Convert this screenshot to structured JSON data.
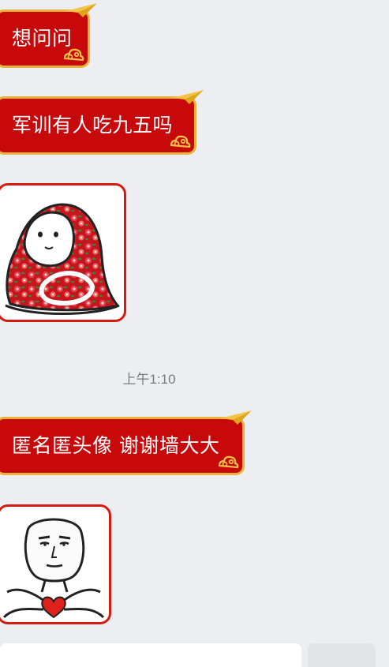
{
  "messages": [
    {
      "type": "text",
      "text": "想问问"
    },
    {
      "type": "text",
      "text": "军训有人吃九五吗"
    },
    {
      "type": "sticker",
      "sticker": "blanket-wrapped-face"
    },
    {
      "type": "timestamp",
      "text": "上午1:10"
    },
    {
      "type": "text",
      "text": "匿名匿头像 谢谢墙大大"
    },
    {
      "type": "sticker",
      "sticker": "heart-hands-meme-face"
    }
  ],
  "colors": {
    "background": "#eceef1",
    "bubble_red": "#c8090b",
    "bubble_border_gold": "#e9b23a",
    "sticker_border": "#d31b12",
    "timestamp_gray": "#7b7b7b"
  }
}
